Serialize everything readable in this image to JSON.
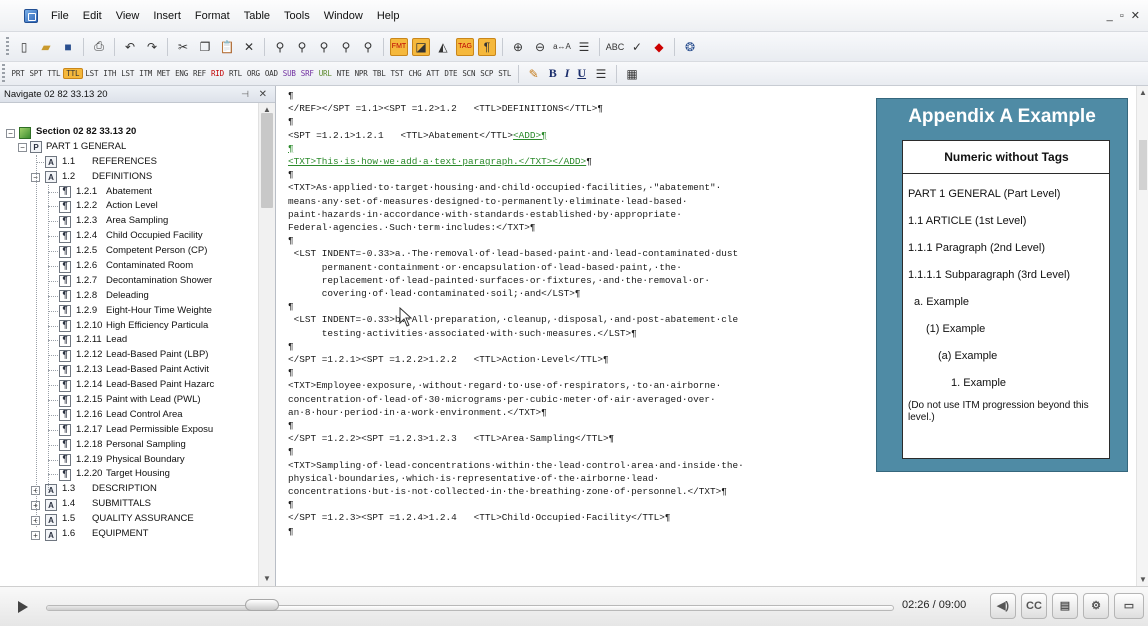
{
  "menu": [
    "File",
    "Edit",
    "View",
    "Insert",
    "Format",
    "Table",
    "Tools",
    "Window",
    "Help"
  ],
  "window_controls": "_ ▫ ✕",
  "toolbar2_tags": [
    "PRT",
    "SPT",
    "TTL",
    "TTL",
    "LST",
    "ITH",
    "LST",
    "ITM",
    "MET",
    "ENG",
    "REF",
    "RID",
    "RTL",
    "ORG",
    "OAD",
    "SUB",
    "SRF",
    "URL",
    "NTE",
    "NPR",
    "TBL",
    "TST",
    "CHG",
    "ATT",
    "DTE",
    "SCN",
    "SCP",
    "STL"
  ],
  "format_buttons": [
    "B",
    "I",
    "U"
  ],
  "navigator": {
    "title": "Navigate 02 82 33.13 20",
    "pin": "⊣",
    "close": "✕",
    "section": "Section 02 82 33.13 20",
    "part": "PART 1  GENERAL",
    "nodes": [
      {
        "num": "1.1",
        "label": "REFERENCES",
        "kind": "article"
      },
      {
        "num": "1.2",
        "label": "DEFINITIONS",
        "kind": "article"
      },
      {
        "num": "1.2.1",
        "label": "Abatement",
        "kind": "para"
      },
      {
        "num": "1.2.2",
        "label": "Action Level",
        "kind": "para"
      },
      {
        "num": "1.2.3",
        "label": "Area Sampling",
        "kind": "para"
      },
      {
        "num": "1.2.4",
        "label": "Child Occupied Facility",
        "kind": "para"
      },
      {
        "num": "1.2.5",
        "label": "Competent Person (CP)",
        "kind": "para"
      },
      {
        "num": "1.2.6",
        "label": "Contaminated Room",
        "kind": "para"
      },
      {
        "num": "1.2.7",
        "label": "Decontamination Shower",
        "kind": "para"
      },
      {
        "num": "1.2.8",
        "label": "Deleading",
        "kind": "para"
      },
      {
        "num": "1.2.9",
        "label": "Eight-Hour Time Weighte",
        "kind": "para"
      },
      {
        "num": "1.2.10",
        "label": "High Efficiency Particula",
        "kind": "para"
      },
      {
        "num": "1.2.11",
        "label": "Lead",
        "kind": "para"
      },
      {
        "num": "1.2.12",
        "label": "Lead-Based Paint (LBP)",
        "kind": "para"
      },
      {
        "num": "1.2.13",
        "label": "Lead-Based Paint Activit",
        "kind": "para"
      },
      {
        "num": "1.2.14",
        "label": "Lead-Based Paint Hazarc",
        "kind": "para"
      },
      {
        "num": "1.2.15",
        "label": "Paint with Lead (PWL)",
        "kind": "para"
      },
      {
        "num": "1.2.16",
        "label": "Lead Control Area",
        "kind": "para"
      },
      {
        "num": "1.2.17",
        "label": "Lead Permissible Exposu",
        "kind": "para"
      },
      {
        "num": "1.2.18",
        "label": "Personal Sampling",
        "kind": "para"
      },
      {
        "num": "1.2.19",
        "label": "Physical Boundary",
        "kind": "para"
      },
      {
        "num": "1.2.20",
        "label": "Target Housing",
        "kind": "para"
      },
      {
        "num": "1.3",
        "label": "DESCRIPTION",
        "kind": "article"
      },
      {
        "num": "1.4",
        "label": "SUBMITTALS",
        "kind": "article"
      },
      {
        "num": "1.5",
        "label": "QUALITY ASSURANCE",
        "kind": "article"
      },
      {
        "num": "1.6",
        "label": "EQUIPMENT",
        "kind": "article"
      }
    ]
  },
  "editor": {
    "lines": [
      "¶",
      "</REF></SPT =1.1><SPT =1.2>1.2   <TTL>DEFINITIONS</TTL>¶",
      "¶",
      "<SPT =1.2.1>1.2.1   <TTL>Abatement</TTL>",
      "¶",
      "<TXT>This·is·how·we·add·a·text·paragraph.</TXT></ADD>",
      "¶",
      "<TXT>As·applied·to·target·housing·and·child·occupied·facilities,·\"abatement\"·",
      "means·any·set·of·measures·designed·to·permanently·eliminate·lead-based·",
      "paint·hazards·in·accordance·with·standards·established·by·appropriate·",
      "Federal·agencies.·Such·term·includes:</TXT>¶",
      "¶",
      " <LST INDENT=-0.33>a.·The·removal·of·lead-based·paint·and·lead-contaminated·dust",
      "      permanent·containment·or·encapsulation·of·lead-based·paint,·the·",
      "      replacement·of·lead-painted·surfaces·or·fixtures,·and·the·removal·or·",
      "      covering·of·lead·contaminated·soil;·and</LST>¶",
      "¶",
      " <LST INDENT=-0.33>b.·All·preparation,·cleanup,·disposal,·and·post-abatement·cle",
      "      testing·activities·associated·with·such·measures.</LST>¶",
      "¶",
      "</SPT =1.2.1><SPT =1.2.2>1.2.2   <TTL>Action·Level</TTL>¶",
      "¶",
      "<TXT>Employee·exposure,·without·regard·to·use·of·respirators,·to·an·airborne·",
      "concentration·of·lead·of·30·micrograms·per·cubic·meter·of·air·averaged·over·",
      "an·8·hour·period·in·a·work·environment.</TXT>¶",
      "¶",
      "</SPT =1.2.2><SPT =1.2.3>1.2.3   <TTL>Area·Sampling</TTL>¶",
      "¶",
      "<TXT>Sampling·of·lead·concentrations·within·the·lead·control·area·and·inside·the·",
      "physical·boundaries,·which·is·representative·of·the·airborne·lead·",
      "concentrations·but·is·not·collected·in·the·breathing·zone·of·personnel.</TXT>¶",
      "¶",
      "</SPT =1.2.3><SPT =1.2.4>1.2.4   <TTL>Child·Occupied·Facility</TTL>¶",
      "¶"
    ],
    "add_tag": "<ADD>¶",
    "add_close": "¶"
  },
  "appendix": {
    "title": "Appendix A Example",
    "heading": "Numeric without Tags",
    "rows": [
      "PART 1   GENERAL (Part Level)",
      "1.1   ARTICLE (1st Level)",
      "1.1.1   Paragraph (2nd Level)",
      "1.1.1.1   Subparagraph (3rd Level)",
      "a.  Example",
      "(1) Example",
      "(a) Example",
      "1.  Example"
    ],
    "note": "(Do not use ITM progression beyond this level.)"
  },
  "player": {
    "time": "02:26 / 09:00",
    "progress": 0.27,
    "cc_label": "CC"
  },
  "colors": {
    "appendix_bg": "#4f8ba5",
    "highlight": "#f5b83c",
    "markup_green": "#2b8a2b"
  }
}
